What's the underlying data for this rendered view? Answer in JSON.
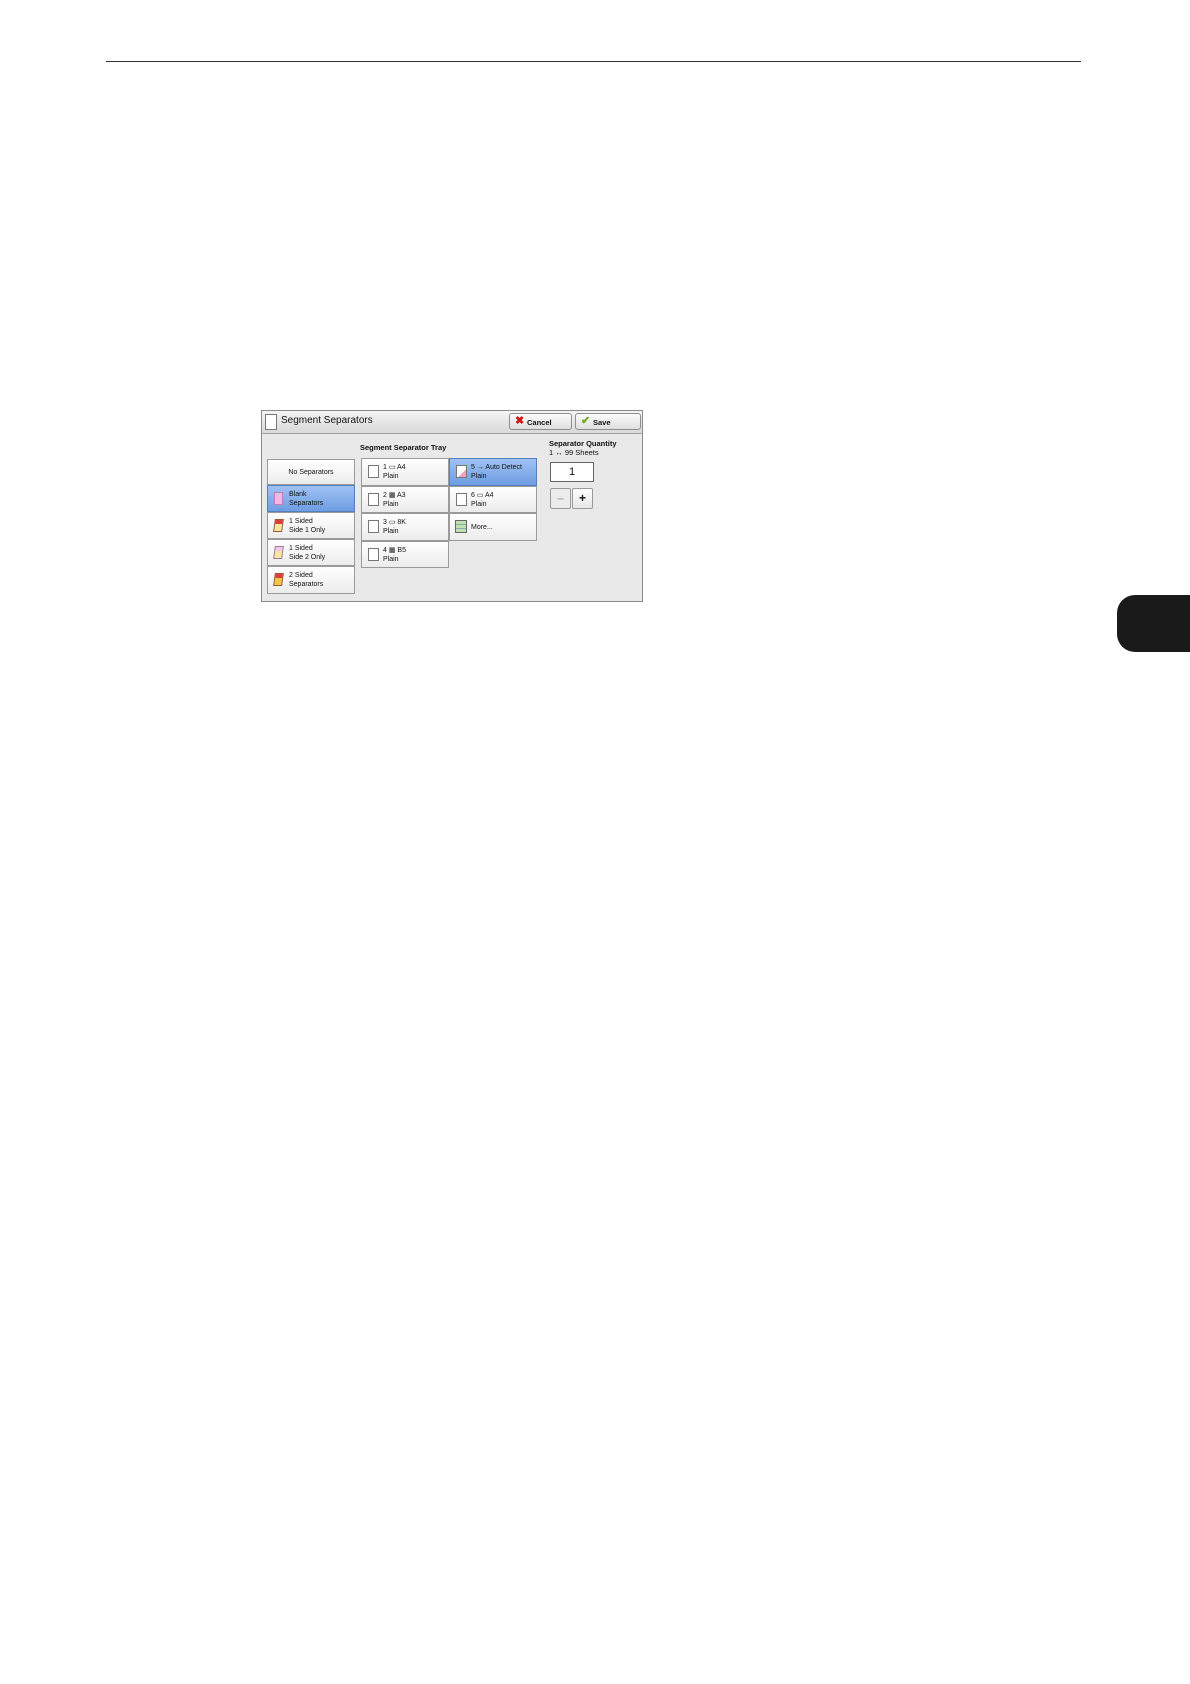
{
  "dialog": {
    "title": "Segment Separators",
    "cancel_label": "Cancel",
    "save_label": "Save"
  },
  "separator_types": [
    {
      "label": "No Separators",
      "selected": false
    },
    {
      "label": "Blank\nSeparators",
      "selected": true
    },
    {
      "label": "1 Sided\nSide 1 Only",
      "selected": false
    },
    {
      "label": "1 Sided\nSide 2 Only",
      "selected": false
    },
    {
      "label": "2 Sided\nSeparators",
      "selected": false
    }
  ],
  "tray": {
    "heading": "Segment Separator Tray",
    "items": [
      {
        "label": "1 ▭ A4\nPlain",
        "selected": false
      },
      {
        "label": "2 ▦ A3\nPlain",
        "selected": false
      },
      {
        "label": "3 ▭ 8K\nPlain",
        "selected": false
      },
      {
        "label": "4 ▦ B5\nPlain",
        "selected": false
      },
      {
        "label": "5 → Auto Detect\nPlain",
        "selected": true
      },
      {
        "label": "6 ▭ A4\nPlain",
        "selected": false
      },
      {
        "label": "More...",
        "selected": false
      }
    ]
  },
  "quantity": {
    "heading": "Separator Quantity",
    "range": "1 ↔ 99 Sheets",
    "value": "1",
    "minus_label": "–",
    "plus_label": "+"
  }
}
